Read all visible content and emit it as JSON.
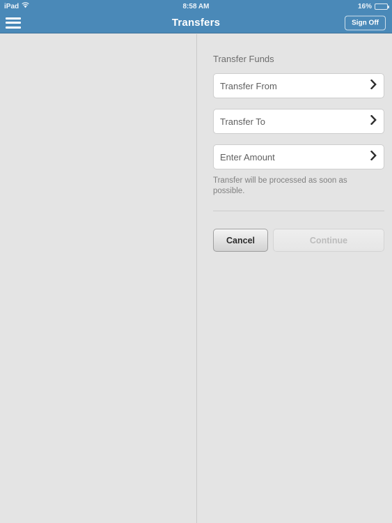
{
  "status_bar": {
    "device_label": "iPad",
    "wifi_icon": "wifi-icon",
    "time": "8:58 AM",
    "battery_percent": "16%",
    "battery_level": 16,
    "battery_icon": "battery-icon"
  },
  "nav_bar": {
    "menu_icon": "hamburger-menu-icon",
    "title": "Transfers",
    "sign_off_label": "Sign Off",
    "background_color": "#4a89b8"
  },
  "main": {
    "section_title": "Transfer Funds",
    "fields": [
      {
        "label": "Transfer From",
        "value": "",
        "chevron_icon": "chevron-right-icon"
      },
      {
        "label": "Transfer To",
        "value": "",
        "chevron_icon": "chevron-right-icon"
      },
      {
        "label": "Enter Amount",
        "value": "",
        "chevron_icon": "chevron-right-icon"
      }
    ],
    "helper_text": "Transfer will be processed as soon as possible.",
    "buttons": {
      "cancel_label": "Cancel",
      "continue_label": "Continue",
      "continue_disabled": true
    }
  },
  "colors": {
    "accent": "#4a89b8",
    "page_background": "#e4e4e4",
    "field_background": "#ffffff",
    "field_border": "#cdcdcd",
    "muted_text": "#808080"
  }
}
